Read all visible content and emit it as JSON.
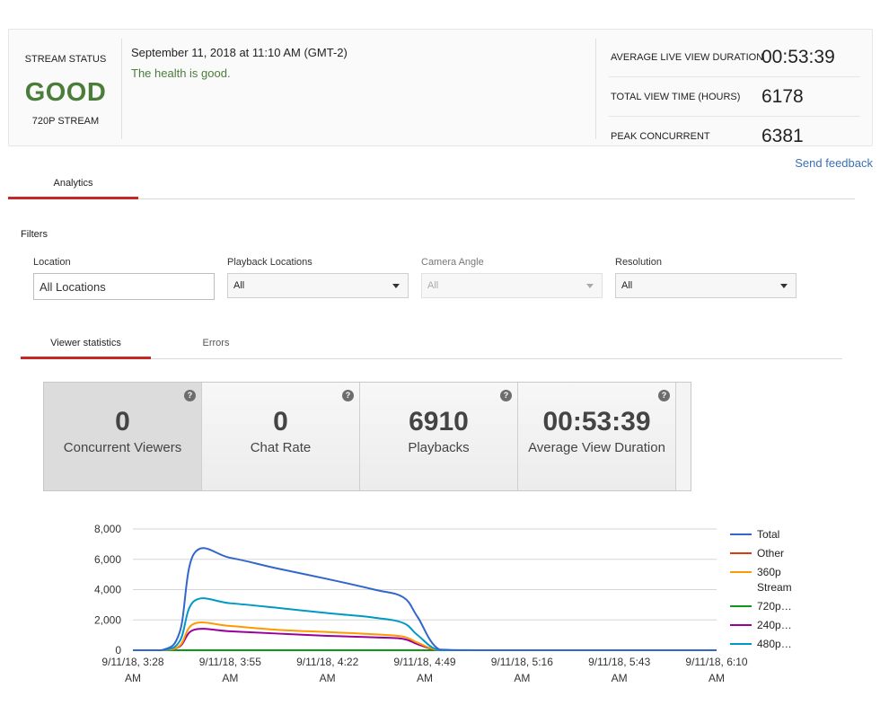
{
  "stream_status": {
    "label": "STREAM STATUS",
    "value": "GOOD",
    "sub": "720P STREAM",
    "date": "September 11, 2018 at 11:10 AM (GMT-2)",
    "health": "The health is good."
  },
  "metrics": [
    {
      "label": "AVERAGE LIVE VIEW DURATION",
      "value": "00:53:39"
    },
    {
      "label": "TOTAL VIEW TIME (HOURS)",
      "value": "6178"
    },
    {
      "label": "PEAK CONCURRENT",
      "value": "6381"
    }
  ],
  "send_feedback": "Send feedback",
  "tabs": [
    {
      "label": "Analytics",
      "active": true
    }
  ],
  "filters": {
    "title": "Filters",
    "location": {
      "label": "Location",
      "value": "All Locations"
    },
    "playback": {
      "label": "Playback Locations",
      "value": "All"
    },
    "camera": {
      "label": "Camera Angle",
      "value": "All"
    },
    "resolution": {
      "label": "Resolution",
      "value": "All"
    }
  },
  "subtabs": [
    {
      "label": "Viewer statistics",
      "active": true
    },
    {
      "label": "Errors",
      "active": false
    }
  ],
  "stats": [
    {
      "value": "0",
      "label": "Concurrent Viewers",
      "selected": true
    },
    {
      "value": "0",
      "label": "Chat Rate",
      "selected": false
    },
    {
      "value": "6910",
      "label": "Playbacks",
      "selected": false
    },
    {
      "value": "00:53:39",
      "label": "Average View Duration",
      "selected": false
    }
  ],
  "help_glyph": "?",
  "colors": {
    "good": "#4b7d3a",
    "accent_red": "#c62828",
    "link": "#3b6fb6"
  },
  "chart_data": {
    "type": "line",
    "title": "",
    "xlabel": "",
    "ylabel": "",
    "x_ticks": [
      [
        "9/11/18, 3:28",
        "AM"
      ],
      [
        "9/11/18, 3:55",
        "AM"
      ],
      [
        "9/11/18, 4:22",
        "AM"
      ],
      [
        "9/11/18, 4:49",
        "AM"
      ],
      [
        "9/11/18, 5:16",
        "AM"
      ],
      [
        "9/11/18, 5:43",
        "AM"
      ],
      [
        "9/11/18, 6:10",
        "AM"
      ]
    ],
    "y_ticks": [
      "0",
      "2,000",
      "4,000",
      "6,000",
      "8,000"
    ],
    "ylim": [
      0,
      8000
    ],
    "x_minutes": [
      0,
      8,
      13,
      17,
      27,
      40,
      54,
      67,
      75,
      79,
      85,
      95,
      110,
      162
    ],
    "legend_position": "right",
    "series": [
      {
        "name": "Total",
        "color": "#3366cc",
        "values": [
          0,
          0,
          1200,
          6380,
          6100,
          5400,
          4700,
          4000,
          3500,
          2200,
          50,
          0,
          0,
          0
        ]
      },
      {
        "name": "Other",
        "color": "#dc3912",
        "values": [
          0,
          0,
          0,
          0,
          0,
          0,
          0,
          0,
          0,
          0,
          0,
          0,
          0,
          0
        ]
      },
      {
        "name": "360p Stream",
        "color": "#ff9900",
        "values": [
          0,
          0,
          300,
          1750,
          1600,
          1350,
          1200,
          1050,
          900,
          500,
          0,
          0,
          0,
          0
        ]
      },
      {
        "name": "720p…",
        "color": "#109618",
        "values": [
          0,
          0,
          0,
          0,
          0,
          0,
          0,
          0,
          0,
          0,
          0,
          0,
          0,
          0
        ]
      },
      {
        "name": "240p…",
        "color": "#990099",
        "values": [
          0,
          0,
          250,
          1350,
          1250,
          1100,
          950,
          850,
          750,
          400,
          0,
          0,
          0,
          0
        ]
      },
      {
        "name": "480p…",
        "color": "#0099c6",
        "values": [
          0,
          0,
          600,
          3250,
          3100,
          2800,
          2450,
          2150,
          1800,
          1000,
          0,
          0,
          0,
          0
        ]
      }
    ]
  }
}
